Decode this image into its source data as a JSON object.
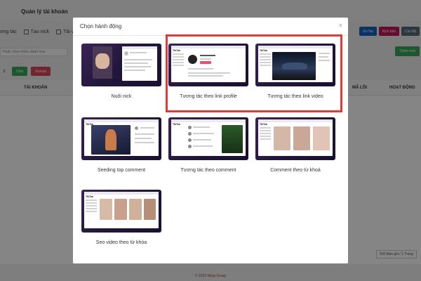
{
  "app": {
    "title": "Quản lý tài khoản",
    "nav": [
      {
        "label": "ơng tác",
        "icon": "interact-icon"
      },
      {
        "label": "Tạo nick",
        "icon": "user-add-icon"
      },
      {
        "label": "Tải video",
        "icon": "video-icon"
      }
    ],
    "actions": [
      {
        "label": "ồn Hai",
        "color": "#1565c0"
      },
      {
        "label": "Kịch bản",
        "color": "#c2185b"
      },
      {
        "label": "Cài đặt",
        "color": "#546e7a"
      }
    ],
    "search_placeholder": "Hoặc chọn nhiều danh mục",
    "add_label": "Thêm mới",
    "row_number": "0",
    "btn_clean": "Clen",
    "btn_reload": "Reload",
    "table_headers": {
      "account": "TÀI KHOẢN",
      "error": "MÃ LỖI",
      "activity": "HOẠT ĐỘNG"
    },
    "paging": "500 Bản ghi / 1 Trang",
    "footer_prefix": "© 2023",
    "footer_brand": "Ninja Group"
  },
  "modal": {
    "title": "Chọn hành động",
    "close_glyph": "×",
    "cards": [
      {
        "label": "Nuôi nick",
        "theme": "dark"
      },
      {
        "label": "Tương tác theo link profile",
        "theme": "light"
      },
      {
        "label": "Tương tác theo link video",
        "theme": "dark"
      },
      {
        "label": "Seeding top comment",
        "theme": "dark"
      },
      {
        "label": "Tương tác theo comment",
        "theme": "light"
      },
      {
        "label": "Comment theo từ khoá",
        "theme": "dark"
      },
      {
        "label": "Seo video theo từ khóa",
        "theme": "light"
      }
    ]
  },
  "colors": {
    "highlight": "#e53935",
    "thumb_dark": "#2a1a45",
    "brand_red": "#c0392b"
  }
}
